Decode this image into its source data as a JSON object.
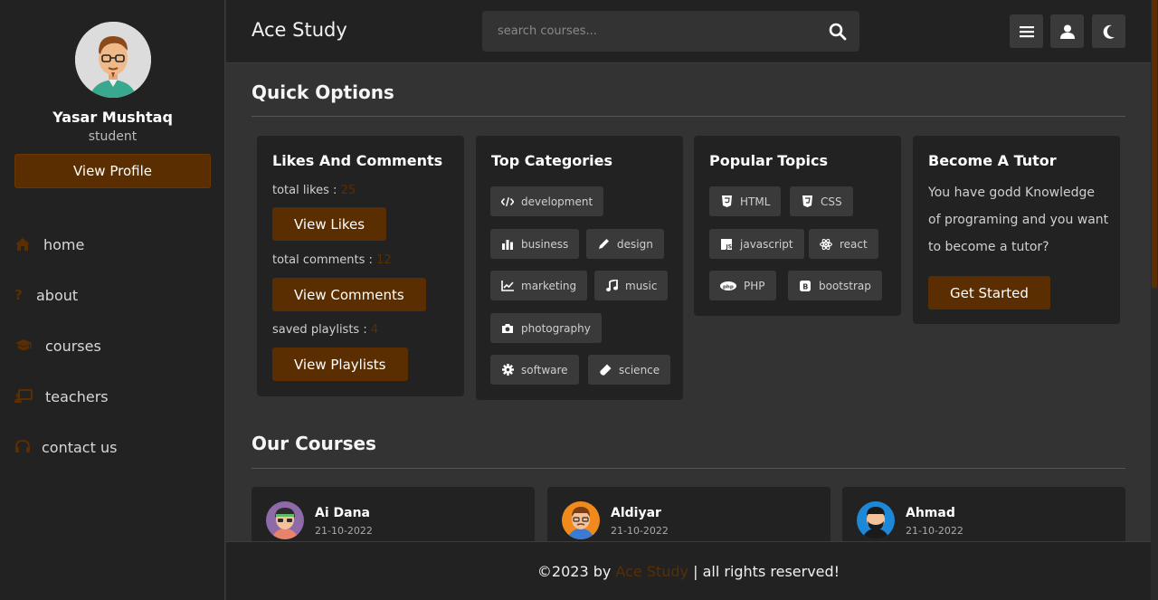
{
  "sidebar": {
    "profile_name": "Yasar Mushtaq",
    "profile_role": "student",
    "view_profile_label": "View Profile",
    "nav": [
      {
        "label": "home",
        "icon": "home-icon"
      },
      {
        "label": "about",
        "icon": "question-icon"
      },
      {
        "label": "courses",
        "icon": "graduation-cap-icon"
      },
      {
        "label": "teachers",
        "icon": "chalkboard-teacher-icon"
      },
      {
        "label": "contact us",
        "icon": "headset-icon"
      }
    ]
  },
  "header": {
    "logo": "Ace Study",
    "search_placeholder": "search courses...",
    "buttons": [
      "menu-icon",
      "user-icon",
      "moon-icon"
    ]
  },
  "quick_options": {
    "title": "Quick Options",
    "likes": {
      "title": "Likes And Comments",
      "total_likes_label": "total likes : ",
      "total_likes": "25",
      "view_likes": "View Likes",
      "total_comments_label": "total comments : ",
      "total_comments": "12",
      "view_comments": "View Comments",
      "saved_playlists_label": "saved playlists : ",
      "saved_playlists": "4",
      "view_playlists": "View Playlists"
    },
    "categories": {
      "title": "Top Categories",
      "items": [
        "development",
        "business",
        "design",
        "marketing",
        "music",
        "photography",
        "software",
        "science"
      ]
    },
    "topics": {
      "title": "Popular Topics",
      "items": [
        "HTML",
        "CSS",
        "javascript",
        "react",
        "PHP",
        "bootstrap"
      ]
    },
    "tutor": {
      "title": "Become A Tutor",
      "text": "You have godd Knowledge of programing and you want to become a tutor?",
      "button": "Get Started"
    }
  },
  "courses": {
    "title": "Our Courses",
    "cards": [
      {
        "name": "Ai Dana",
        "date": "21-10-2022"
      },
      {
        "name": "Aldiyar",
        "date": "21-10-2022"
      },
      {
        "name": "Ahmad",
        "date": "21-10-2022"
      }
    ]
  },
  "footer": {
    "prefix": "©2023 by ",
    "brand": "Ace Study",
    "suffix": " | all rights reserved!"
  },
  "colors": {
    "accent": "#5a2e00",
    "background": "#333333",
    "panel": "#222222"
  }
}
